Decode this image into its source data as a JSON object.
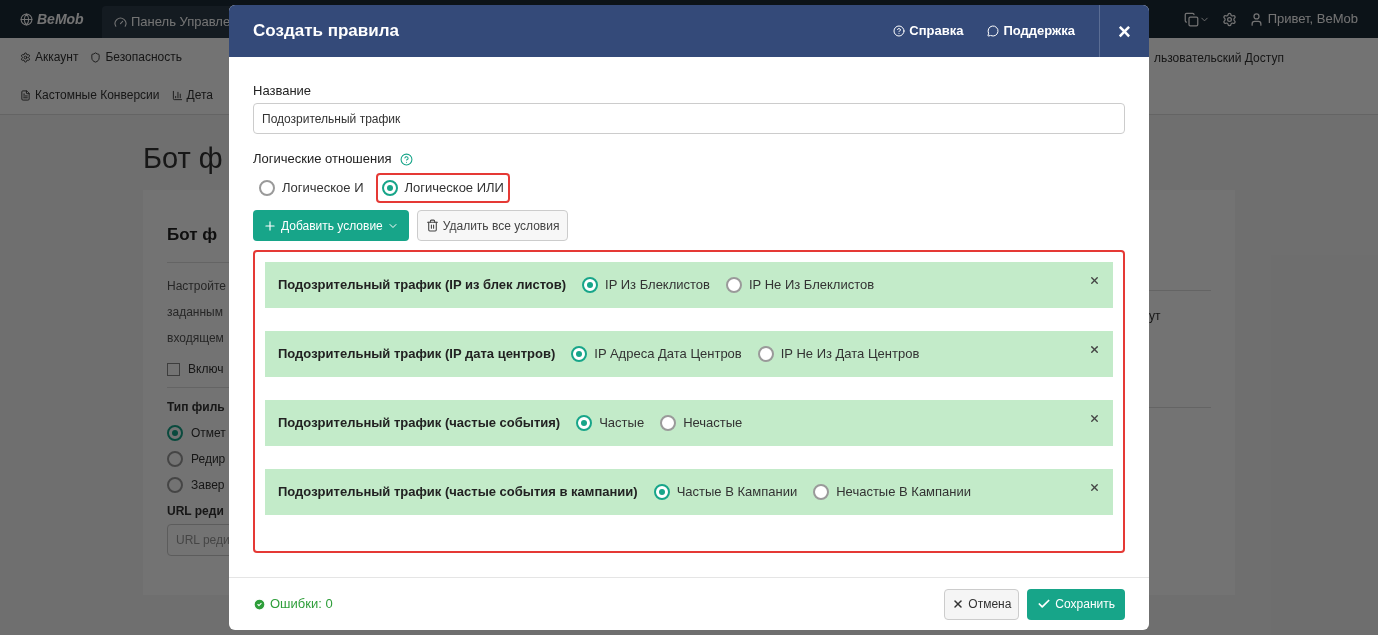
{
  "navbar": {
    "logo": "BeMob",
    "tab": "Панель Управле",
    "user": "Привет, BeMob"
  },
  "subnav": {
    "row_1": [
      {
        "label": "Аккаунт"
      },
      {
        "label": "Безопасность"
      }
    ],
    "row_1_right": "льзовательский Доступ",
    "row_2": [
      {
        "label": "Кастомные Конверсии"
      },
      {
        "label": "Дета"
      }
    ]
  },
  "page": {
    "title": "Бот ф",
    "card": {
      "title": "Бот ф",
      "description": [
        "Настройте",
        "заданным",
        "входящем"
      ],
      "enable": {
        "label": "Включ",
        "checked": false
      },
      "filter_type_label": "Тип филь",
      "filter_types": [
        {
          "label": "Отмет",
          "selected": true
        },
        {
          "label": "Редир",
          "selected": false
        },
        {
          "label": "Завер",
          "selected": false
        }
      ],
      "url_label": "URL реди",
      "url_placeholder": "URL реди",
      "right_text": "ут"
    }
  },
  "modal": {
    "title": "Создать правила",
    "help": "Справка",
    "support": "Поддержка",
    "close": "×",
    "name_label": "Название",
    "name_value": "Подозрительный трафик",
    "logic_label": "Логические отношения",
    "logic_options": [
      {
        "label": "Логическое И",
        "selected": false,
        "highlighted": false
      },
      {
        "label": "Логическое ИЛИ",
        "selected": true,
        "highlighted": true
      }
    ],
    "add_button": "Добавить условие",
    "delete_button": "Удалить все условия",
    "conditions_highlighted": true,
    "conditions": [
      {
        "label": "Подозрительный трафик (IP из блек листов)",
        "options": [
          {
            "label": "IP Из Блеклистов",
            "selected": true
          },
          {
            "label": "IP Не Из Блеклистов",
            "selected": false
          }
        ]
      },
      {
        "label": "Подозрительный трафик (IP дата центров)",
        "options": [
          {
            "label": "IP Адреса Дата Центров",
            "selected": true
          },
          {
            "label": "IP Не Из Дата Центров",
            "selected": false
          }
        ]
      },
      {
        "label": "Подозрительный трафик (частые события)",
        "options": [
          {
            "label": "Частые",
            "selected": true
          },
          {
            "label": "Нечастые",
            "selected": false
          }
        ]
      },
      {
        "label": "Подозрительный трафик (частые события в кампании)",
        "options": [
          {
            "label": "Частые В Кампании",
            "selected": true
          },
          {
            "label": "Нечастые В Кампании",
            "selected": false
          }
        ]
      }
    ],
    "errors": "Ошибки: 0",
    "cancel": "Отмена",
    "save": "Сохранить"
  }
}
